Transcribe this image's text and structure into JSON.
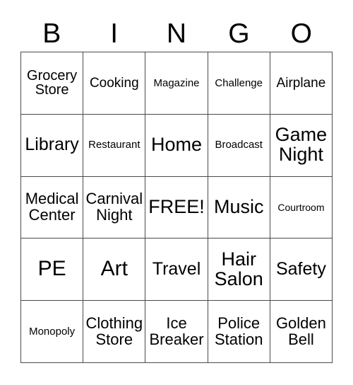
{
  "card": {
    "title_letters": [
      "B",
      "I",
      "N",
      "G",
      "O"
    ],
    "rows": [
      [
        {
          "text": "Grocery\nStore",
          "size": "fs-ml"
        },
        {
          "text": "Cooking",
          "size": "fs-m"
        },
        {
          "text": "Magazine",
          "size": "fs-s"
        },
        {
          "text": "Challenge",
          "size": "fs-s"
        },
        {
          "text": "Airplane",
          "size": "fs-m"
        }
      ],
      [
        {
          "text": "Library",
          "size": "fs-xl"
        },
        {
          "text": "Restaurant",
          "size": "fs-s"
        },
        {
          "text": "Home",
          "size": "fs-xxl"
        },
        {
          "text": "Broadcast",
          "size": "fs-s"
        },
        {
          "text": "Game\nNight",
          "size": "fs-xxl"
        }
      ],
      [
        {
          "text": "Medical\nCenter",
          "size": "fs-l"
        },
        {
          "text": "Carnival\nNight",
          "size": "fs-l"
        },
        {
          "text": "FREE!",
          "size": "fs-xxl"
        },
        {
          "text": "Music",
          "size": "fs-xxl"
        },
        {
          "text": "Courtroom",
          "size": "fs-xs"
        }
      ],
      [
        {
          "text": "PE",
          "size": "fs-huge"
        },
        {
          "text": "Art",
          "size": "fs-huge"
        },
        {
          "text": "Travel",
          "size": "fs-xl"
        },
        {
          "text": "Hair\nSalon",
          "size": "fs-xxl"
        },
        {
          "text": "Safety",
          "size": "fs-xl"
        }
      ],
      [
        {
          "text": "Monopoly",
          "size": "fs-s"
        },
        {
          "text": "Clothing\nStore",
          "size": "fs-l"
        },
        {
          "text": "Ice\nBreaker",
          "size": "fs-l"
        },
        {
          "text": "Police\nStation",
          "size": "fs-l"
        },
        {
          "text": "Golden\nBell",
          "size": "fs-l"
        }
      ]
    ]
  }
}
